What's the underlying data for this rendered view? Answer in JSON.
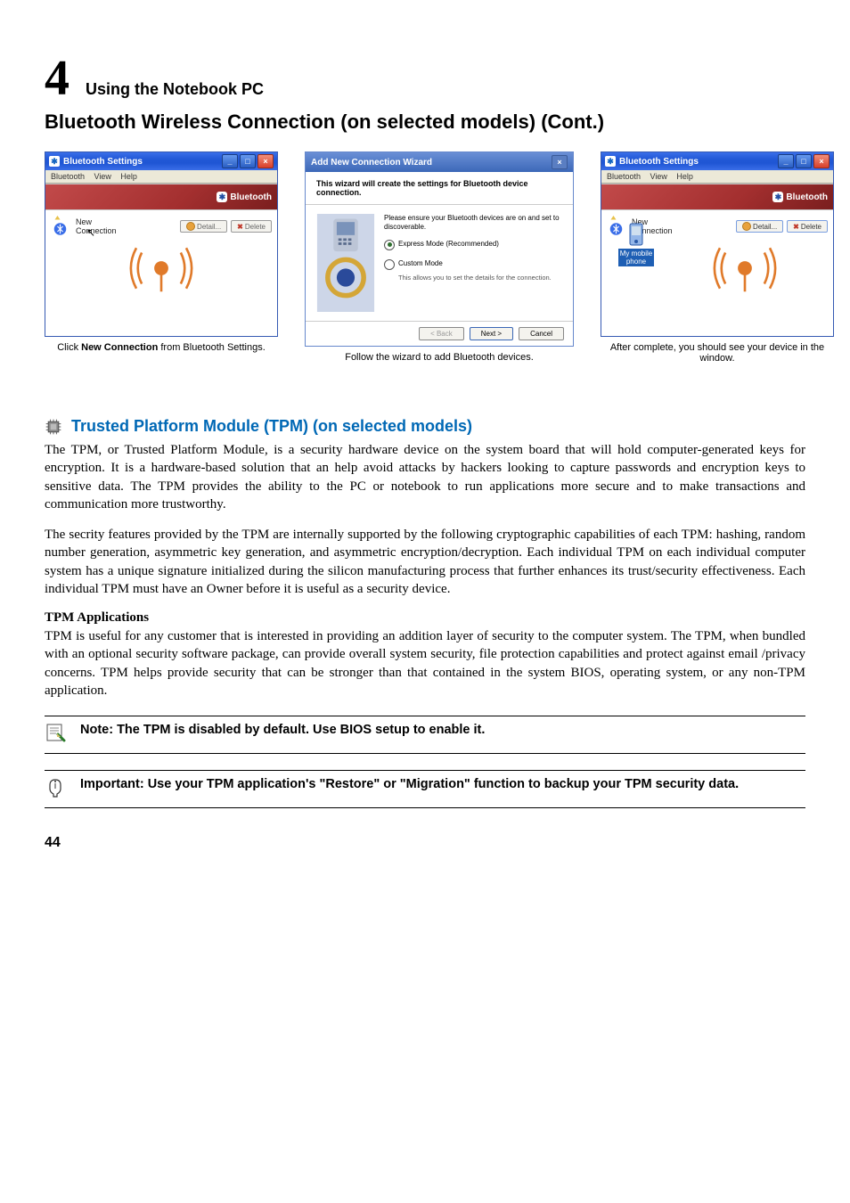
{
  "chapter": {
    "num": "4",
    "title": "Using the Notebook PC"
  },
  "section_title": "Bluetooth Wireless Connection (on selected models) (Cont.)",
  "win1": {
    "title": "Bluetooth Settings",
    "menu": {
      "bluetooth": "Bluetooth",
      "view": "View",
      "help": "Help"
    },
    "bt_logo": "Bluetooth",
    "new_conn_top": "New",
    "new_conn_bottom": "Connection",
    "detail": "Detail...",
    "delete": "Delete"
  },
  "caption1_pre": "Click ",
  "caption1_bold": "New Connection",
  "caption1_post": " from Bluetooth Settings.",
  "win2": {
    "title": "Add New Connection Wizard",
    "header": "This wizard will create the settings for Bluetooth device connection.",
    "note": "Please ensure your Bluetooth devices are on and set to discoverable.",
    "opt1": "Express Mode (Recommended)",
    "opt2": "Custom Mode",
    "opt2_sub": "This allows you to set the details for the connection.",
    "back": "< Back",
    "next": "Next >",
    "cancel": "Cancel"
  },
  "caption2": "Follow the wizard to add Bluetooth devices.",
  "win3": {
    "title": "Bluetooth Settings",
    "menu": {
      "bluetooth": "Bluetooth",
      "view": "View",
      "help": "Help"
    },
    "bt_logo": "Bluetooth",
    "device_top": "My mobile",
    "device_bottom": "phone",
    "new_conn_top": "New",
    "new_conn_bottom": "Connection",
    "detail": "Detail...",
    "delete": "Delete"
  },
  "caption3": "After complete, you should see your device in the window.",
  "tpm": {
    "title": "Trusted Platform Module (TPM) (on selected models)",
    "p1": "The TPM, or Trusted Platform Module, is a security hardware device on the system board that will hold computer-generated keys for encryption. It is a hardware-based solution that an help avoid attacks by hackers looking to capture passwords and encryption keys to sensitive data. The TPM provides the ability to the PC or notebook to run applications more secure and to make transactions and communication more trustworthy.",
    "p2": "The secrity features provided by the TPM are internally supported by the following cryptographic capabilities of each TPM: hashing, random number generation, asymmetric key generation, and asymmetric encryption/decryption. Each individual TPM on each individual computer system has a unique signature initialized during the silicon manufacturing process that further enhances its trust/security effectiveness. Each individual TPM must have an Owner before it is useful as a security device.",
    "sub": "TPM Applications",
    "p3": "TPM is useful for any customer that is interested in providing an addition layer of security to the computer system. The TPM, when bundled with an optional security software package, can provide overall system security, file protection capabilities and protect against email /privacy concerns. TPM helps provide security that can be stronger than that contained in the system BIOS, operating system, or any non-TPM application."
  },
  "note_callout": "Note: The TPM is disabled by default. Use BIOS setup to enable it.",
  "important_callout": "Important: Use your TPM application's \"Restore\" or \"Migration\" function to backup your TPM security data.",
  "page_num": "44"
}
